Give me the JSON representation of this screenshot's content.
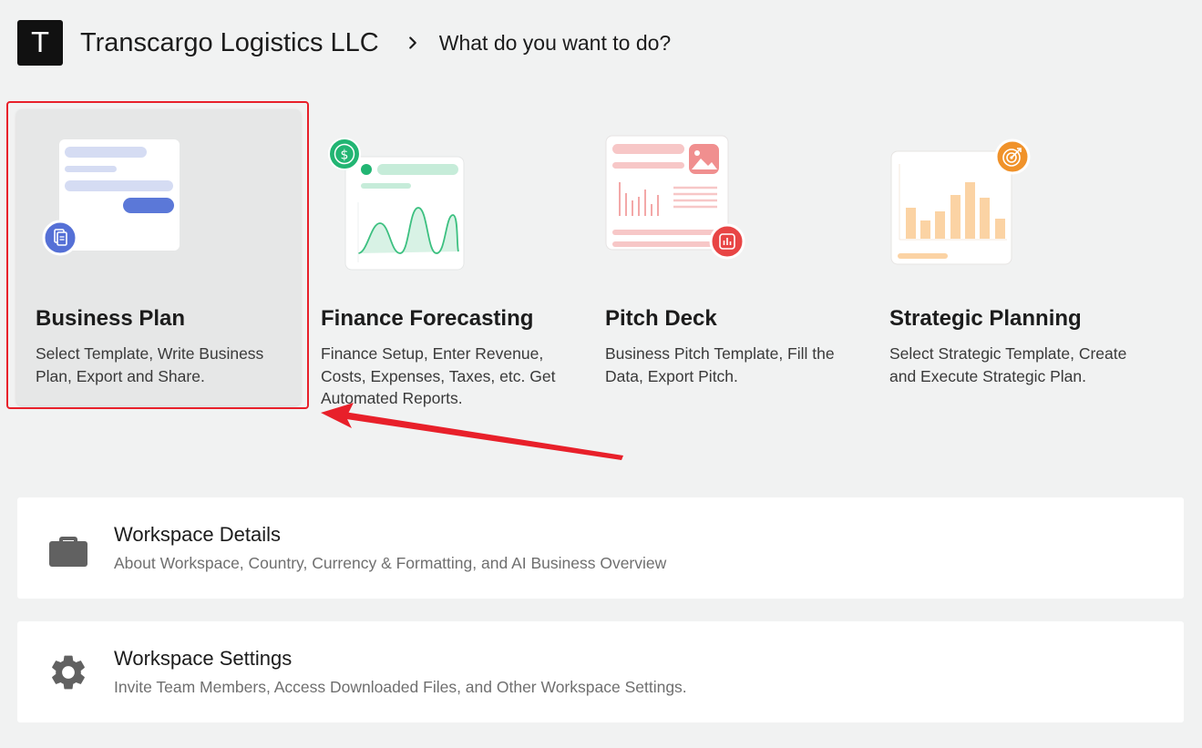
{
  "header": {
    "avatar_letter": "T",
    "workspace_name": "Transcargo Logistics LLC",
    "page_title": "What do you want to do?"
  },
  "cards": [
    {
      "title": "Business Plan",
      "description": "Select Template, Write Business Plan, Export and Share.",
      "badge_icon": "document-icon",
      "accent": "#5570d6"
    },
    {
      "title": "Finance Forecasting",
      "description": "Finance Setup, Enter Revenue, Costs, Expenses, Taxes, etc. Get Automated Reports.",
      "badge_icon": "dollar-icon",
      "accent": "#22b573"
    },
    {
      "title": "Pitch Deck",
      "description": "Business Pitch Template, Fill the Data, Export Pitch.",
      "badge_icon": "chart-icon",
      "accent": "#e84545"
    },
    {
      "title": "Strategic Planning",
      "description": "Select Strategic Template, Create and Execute Strategic Plan.",
      "badge_icon": "target-icon",
      "accent": "#f0922a"
    }
  ],
  "rows": [
    {
      "title": "Workspace Details",
      "description": "About Workspace, Country, Currency & Formatting, and AI Business Overview",
      "icon": "briefcase-icon"
    },
    {
      "title": "Workspace Settings",
      "description": "Invite Team Members, Access Downloaded Files, and Other Workspace Settings.",
      "icon": "gear-icon"
    }
  ],
  "colors": {
    "background": "#f1f2f2",
    "highlight": "#e8202a",
    "icon_gray": "#616161"
  }
}
